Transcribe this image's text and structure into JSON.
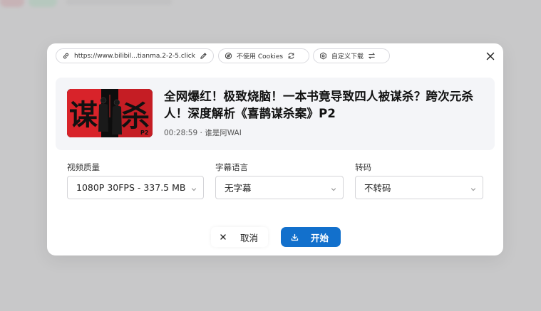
{
  "toolbar": {
    "url_text": "https://www.bilibil...tianma.2-2-5.click",
    "cookies_label": "不使用 Cookies",
    "custom_download_label": "自定义下载"
  },
  "video": {
    "title": "全网爆红！极致烧脑！一本书竟导致四人被谋杀？跨次元杀人！深度解析《喜鹊谋杀案》P2",
    "duration": "00:28:59",
    "separator": "·",
    "uploader": "谁是阿WAI",
    "thumbnail_text_left": "谋",
    "thumbnail_text_right": "杀",
    "thumbnail_badge": "P2"
  },
  "fields": {
    "quality": {
      "label": "视频质量",
      "value": "1080P 30FPS - 337.5 MB"
    },
    "subtitle": {
      "label": "字幕语言",
      "value": "无字幕"
    },
    "transcode": {
      "label": "转码",
      "value": "不转码"
    }
  },
  "actions": {
    "cancel_label": "取消",
    "start_label": "开始"
  },
  "colors": {
    "accent": "#1270cc",
    "overlay": "#c8c8c9",
    "card_bg": "#f4f5f8",
    "thumbnail_red": "#d8232a"
  },
  "icons": {
    "url_chip": "link-icon",
    "url_edit": "pencil-icon",
    "cookies_chip": "cookie-icon",
    "cookies_refresh": "refresh-icon",
    "custom_chip": "gear-icon",
    "custom_swap": "swap-icon",
    "close": "close-icon",
    "cancel": "x-icon",
    "start": "download-icon"
  }
}
